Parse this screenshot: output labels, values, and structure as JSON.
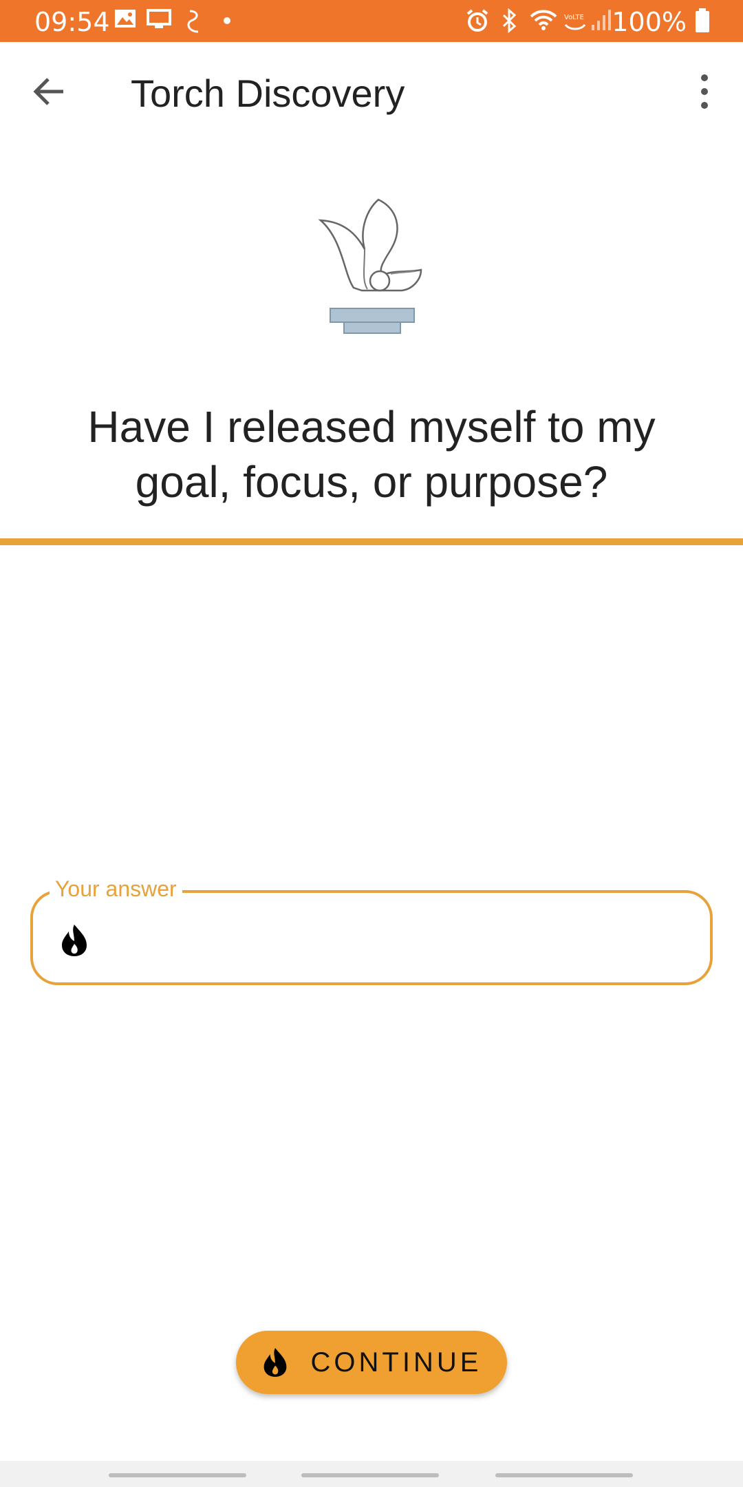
{
  "status_bar": {
    "time": "09:54",
    "battery": "100%",
    "icons_left": [
      "gallery-icon",
      "screen-cast-icon",
      "samsung-health-icon",
      "dot-icon"
    ],
    "icons_right": [
      "alarm-icon",
      "bluetooth-icon",
      "wifi-icon",
      "volte-icon",
      "signal-icon",
      "battery-icon"
    ],
    "color": "#EE752A"
  },
  "appbar": {
    "title": "Torch Discovery",
    "back_icon": "arrow-back-icon",
    "more_icon": "more-vert-icon"
  },
  "logo": {
    "icon": "torch-logo-icon"
  },
  "question": {
    "text": "Have I released myself to my goal, focus, or purpose?"
  },
  "answer": {
    "label": "Your answer",
    "value": "",
    "icon": "flame-icon",
    "accent": "#E8A23A"
  },
  "continue_button": {
    "label": "CONTINUE",
    "icon": "flame-icon",
    "color": "#F0A030"
  }
}
